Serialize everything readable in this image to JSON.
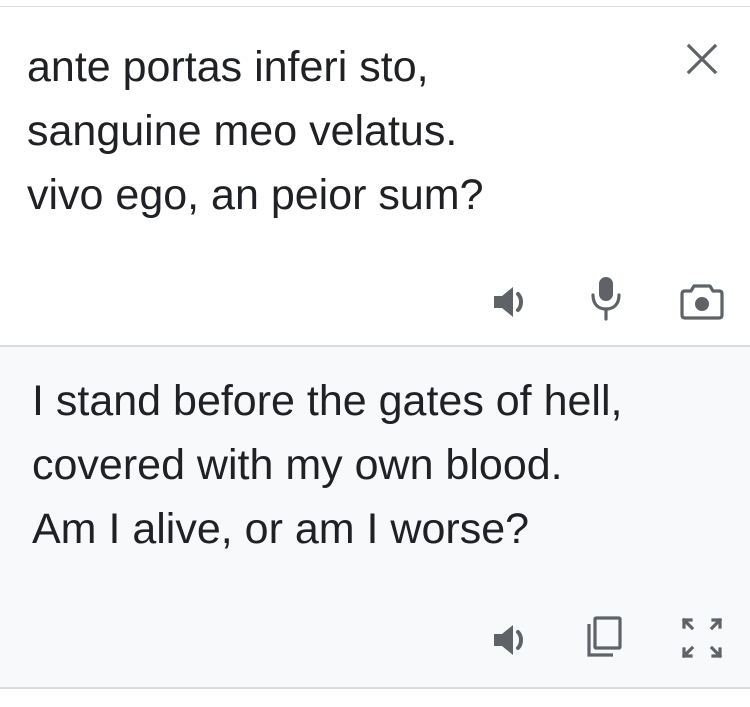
{
  "source": {
    "text": "ante portas inferi sto,\nsanguine meo velatus.\nvivo ego, an peior sum?",
    "actions": {
      "clear_icon": "close-icon",
      "listen_icon": "speaker-icon",
      "voice_icon": "microphone-icon",
      "camera_icon": "camera-icon"
    }
  },
  "translation": {
    "text": "I stand before the gates of hell,\ncovered with my own blood.\nAm I alive, or am I worse?",
    "actions": {
      "listen_icon": "speaker-icon",
      "copy_icon": "copy-icon",
      "fullscreen_icon": "fullscreen-icon"
    }
  },
  "colors": {
    "text": "#202124",
    "icon": "#5f6368",
    "result_background": "#f8f9fa",
    "divider": "#dadce0"
  }
}
